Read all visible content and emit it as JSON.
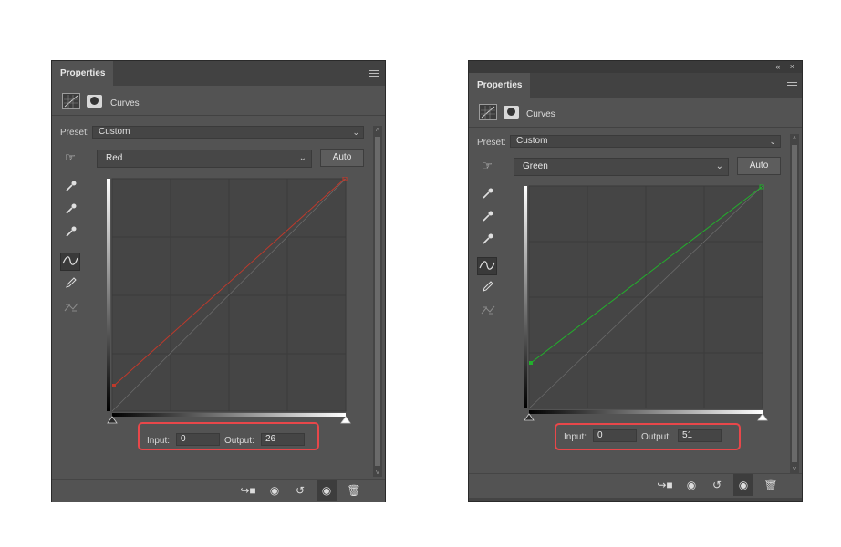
{
  "panels": [
    {
      "tab_label": "Properties",
      "adjustment_title": "Curves",
      "preset_label": "Preset:",
      "preset_value": "Custom",
      "channel_value": "Red",
      "auto_label": "Auto",
      "input_label": "Input:",
      "input_value": "0",
      "output_label": "Output:",
      "output_value": "26",
      "curve_color": "#c0392b"
    },
    {
      "tab_label": "Properties",
      "adjustment_title": "Curves",
      "preset_label": "Preset:",
      "preset_value": "Custom",
      "channel_value": "Green",
      "auto_label": "Auto",
      "input_label": "Input:",
      "input_value": "0",
      "output_label": "Output:",
      "output_value": "51",
      "curve_color": "#22b02c"
    }
  ],
  "colors": {
    "panel_bg": "#535353",
    "highlight_box": "#e8474a"
  },
  "icons": {
    "tools": [
      "on-image-adjust-icon",
      "sample-black-eyedropper-icon",
      "sample-gray-eyedropper-icon",
      "sample-white-eyedropper-icon",
      "curve-points-icon",
      "pencil-draw-icon",
      "smooth-curve-icon"
    ],
    "footer": [
      "clip-to-layer-icon",
      "view-previous-state-icon",
      "reset-icon",
      "visibility-eye-icon",
      "trash-icon"
    ]
  }
}
